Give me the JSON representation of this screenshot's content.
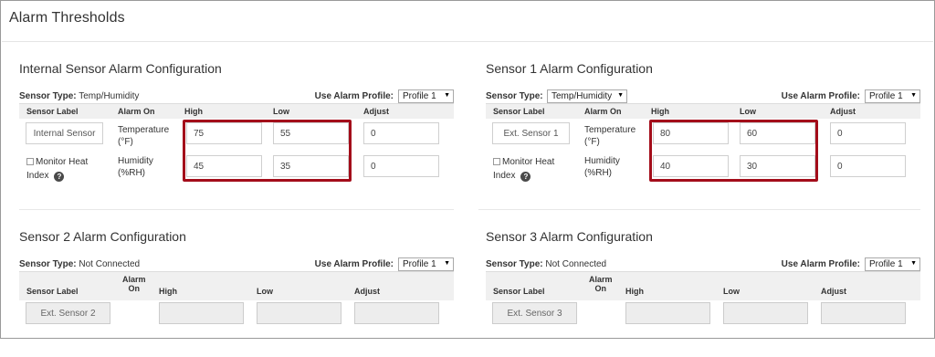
{
  "page": {
    "title": "Alarm Thresholds"
  },
  "common": {
    "sensor_type_label": "Sensor Type:",
    "use_profile_label": "Use Alarm Profile:",
    "headers": {
      "sensor_label": "Sensor Label",
      "alarm_on": "Alarm On",
      "alarm_on_split": [
        "Alarm",
        "On"
      ],
      "high": "High",
      "low": "Low",
      "adjust": "Adjust"
    },
    "monitor_heat_index": [
      "Monitor Heat",
      "Index"
    ]
  },
  "internal": {
    "title": "Internal Sensor Alarm Configuration",
    "sensor_type": "Temp/Humidity",
    "profile": "Profile 1",
    "label": "Internal Sensor",
    "rows": [
      {
        "alarm_on": [
          "Temperature",
          "(°F)"
        ],
        "high": "75",
        "low": "55",
        "adjust": "0"
      },
      {
        "alarm_on": [
          "Humidity",
          "(%RH)"
        ],
        "high": "45",
        "low": "35",
        "adjust": "0"
      }
    ]
  },
  "sensor1": {
    "title": "Sensor 1 Alarm Configuration",
    "sensor_type": "Temp/Humidity",
    "profile": "Profile 1",
    "label": "Ext. Sensor 1",
    "rows": [
      {
        "alarm_on": [
          "Temperature",
          "(°F)"
        ],
        "high": "80",
        "low": "60",
        "adjust": "0"
      },
      {
        "alarm_on": [
          "Humidity",
          "(%RH)"
        ],
        "high": "40",
        "low": "30",
        "adjust": "0"
      }
    ]
  },
  "sensor2": {
    "title": "Sensor 2 Alarm Configuration",
    "sensor_type": "Not Connected",
    "profile": "Profile 1",
    "label": "Ext. Sensor 2"
  },
  "sensor3": {
    "title": "Sensor 3 Alarm Configuration",
    "sensor_type": "Not Connected",
    "profile": "Profile 1",
    "label": "Ext. Sensor 3"
  },
  "colors": {
    "highlight": "#a30d1a",
    "header_bg": "#f0f0f0",
    "disabled_bg": "#ededed"
  },
  "icons": {
    "help": "help-icon",
    "dropdown": "chevron-down-icon"
  }
}
